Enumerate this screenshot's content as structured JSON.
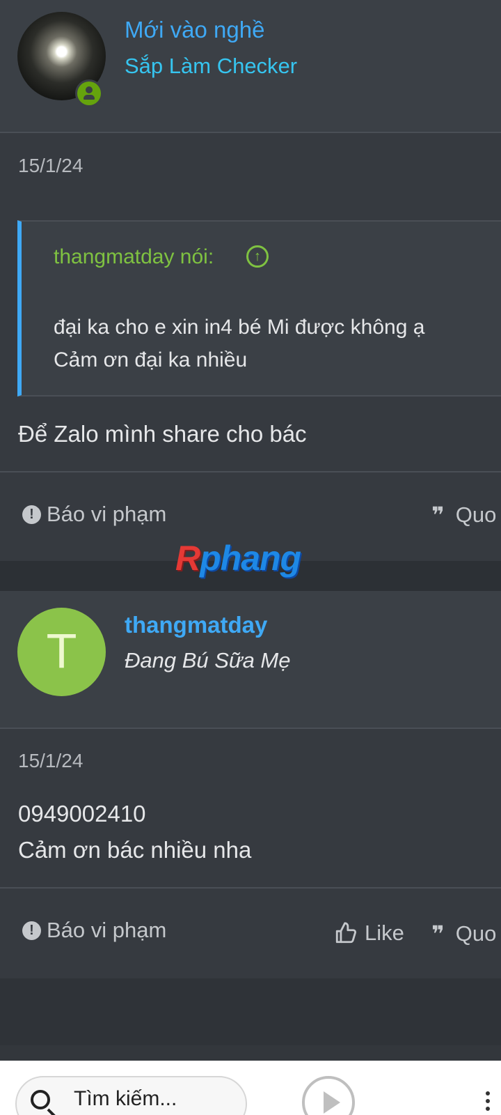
{
  "posts": [
    {
      "username": "Mới vào nghề",
      "user_title": "Sắp Làm Checker",
      "date": "15/1/24",
      "quote": {
        "author": "thangmatday nói:",
        "lines": [
          "đại ka cho e xin in4 bé Mi được không ạ",
          "Cảm ơn đại ka nhiều"
        ]
      },
      "message_lines": [
        "Để Zalo mình share cho bác"
      ],
      "actions": {
        "report": "Báo vi phạm",
        "quote": "Quo"
      }
    },
    {
      "username": "thangmatday",
      "avatar_letter": "T",
      "user_title": "Đang Bú Sữa Mẹ",
      "date": "15/1/24",
      "message_lines": [
        "0949002410",
        "Cảm ơn bác nhiều nha"
      ],
      "actions": {
        "report": "Báo vi phạm",
        "like": "Like",
        "quote": "Quo"
      }
    }
  ],
  "watermark": {
    "prefix": "R",
    "rest": "phang"
  },
  "search": {
    "placeholder": "Tìm kiếm..."
  },
  "icons": {
    "online": "user-circle-icon",
    "quote_jump": "arrow-up-circle-icon",
    "report": "exclamation-circle-icon",
    "quote": "quote-icon",
    "like": "thumbs-up-icon",
    "search": "search-icon",
    "play": "play-icon",
    "menu": "dots-grid-icon"
  },
  "colors": {
    "accent_blue": "#3fa9f5",
    "user_title_cyan": "#36c5f0",
    "quote_green": "#7fc241",
    "avatar_green": "#8bc34a"
  }
}
